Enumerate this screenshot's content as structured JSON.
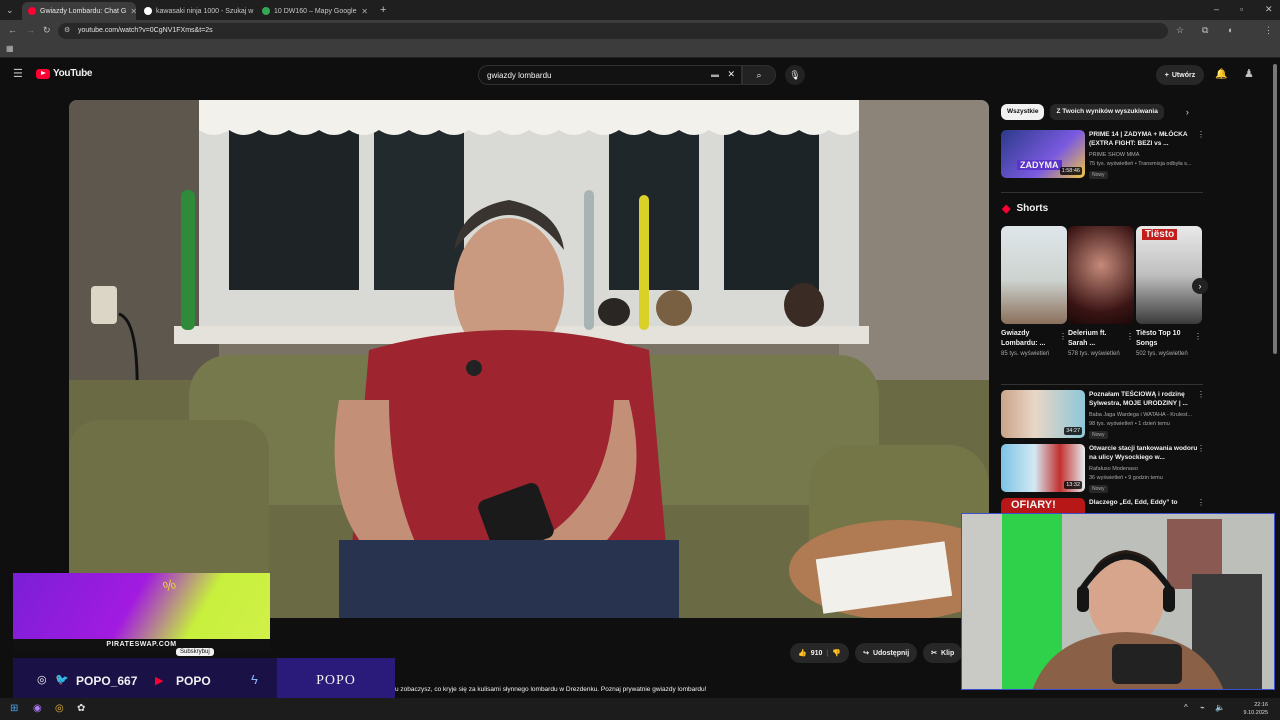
{
  "browser": {
    "tabs": [
      {
        "title": "Gwiazdy Lombardu: Chat G",
        "active": true,
        "favicon_color": "#ff0033"
      },
      {
        "title": "kawasaki ninja 1000 - Szukaj w",
        "active": false,
        "favicon_color": "#ffffff"
      },
      {
        "title": "10 DW160 – Mapy Google",
        "active": false,
        "favicon_color": "#34a853"
      }
    ],
    "url": "youtube.com/watch?v=0CgNV1FXms&t=2s",
    "new_tab": "+"
  },
  "youtube": {
    "logo_text": "YouTube",
    "search_value": "gwiazdy lombardu",
    "create_label": "Utwórz"
  },
  "video": {
    "likes": "910",
    "share_label": "Udostępnij",
    "clip_label": "Klip",
    "description": "Chcesz zobaczyć, co kryje się za kulisami słynnego lombardu w Drezdenku. Poznaj prywatnie gwiazdy lombardu!",
    "description_visible": "u zobaczysz, co kryje się za kulisami słynnego lombardu w Drezdenku. Poznaj prywatnie gwiazdy lombardu!"
  },
  "sidebar": {
    "chips": [
      "Wszystkie",
      "Z Twoich wyników wyszukiwania"
    ],
    "recs": [
      {
        "title": "PRIME 14 | ZADYMA + MŁÓCKA (EXTRA FIGHT: BEZI vs ...",
        "channel": "PRIME SHOW MMA",
        "meta": "75 tys. wyświetleń • Transmisja odbyła s...",
        "badge": "Nowy",
        "duration": "1:58:46",
        "thumb_text": "ZADYMA"
      },
      {
        "title": "Poznałam TEŚCIOWĄ i rodzinę Sylwestra, MOJE URODZINY | ...",
        "channel": "Baba Jaga Wardega i WATAHA - Krulest...",
        "meta": "98 tys. wyświetleń • 1 dzień temu",
        "badge": "Nowy",
        "duration": "34:27"
      },
      {
        "title": "Otwarcie stacji tankowania wodoru na ulicy Wysockiego w...",
        "channel": "Rafałuso Modenaso",
        "meta": "36 wyświetleń • 9 godzin temu",
        "badge": "Nowy",
        "duration": "13:32"
      },
      {
        "title": "Dlaczego „Ed, Edd, Eddy” to",
        "thumb_text": "OFIARY!"
      }
    ],
    "shorts_label": "Shorts",
    "shorts": [
      {
        "title": "Gwiazdy Lombardu: ...",
        "views": "85 tys. wyświetleń"
      },
      {
        "title": "Delerium ft. Sarah ...",
        "views": "578 tys. wyświetleń"
      },
      {
        "title": "Tiësto Top 10 Songs",
        "views": "502 tys. wyświetleń",
        "thumb_text": "Tiësto"
      }
    ]
  },
  "overlay": {
    "promo_site": "PIRATESWAP.COM",
    "subscribe": "Subskrybuj",
    "handle": "POPO_667",
    "yt_name": "POPO",
    "brand": "POPO"
  },
  "taskbar": {
    "time": "22:16",
    "date": "9.10.2025"
  },
  "colors": {
    "yt_red": "#ff0033",
    "bg": "#0f0f0f",
    "overlay_purple": "#1a1147"
  }
}
